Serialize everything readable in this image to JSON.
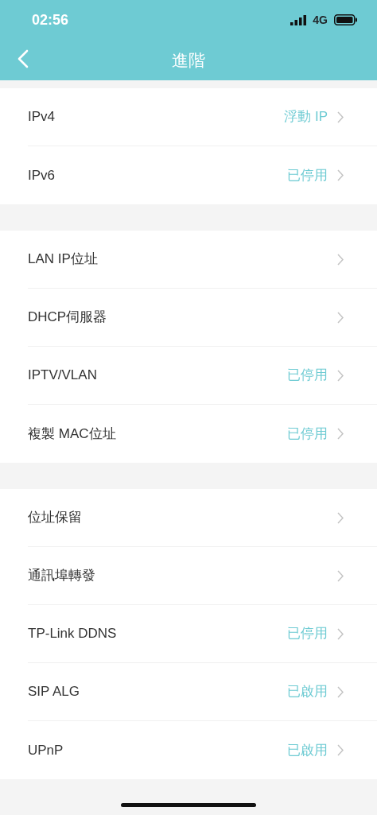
{
  "status_bar": {
    "time": "02:56",
    "network": "4G"
  },
  "header": {
    "title": "進階"
  },
  "groups": [
    {
      "rows": [
        {
          "label": "IPv4",
          "value": "浮動 IP"
        },
        {
          "label": "IPv6",
          "value": "已停用"
        }
      ]
    },
    {
      "rows": [
        {
          "label": "LAN IP位址"
        },
        {
          "label": "DHCP伺服器"
        },
        {
          "label": "IPTV/VLAN",
          "value": "已停用"
        },
        {
          "label": "複製 MAC位址",
          "value": "已停用"
        }
      ]
    },
    {
      "rows": [
        {
          "label": "位址保留"
        },
        {
          "label": "通訊埠轉發"
        },
        {
          "label": "TP-Link DDNS",
          "value": "已停用"
        },
        {
          "label": "SIP ALG",
          "value": "已啟用"
        },
        {
          "label": "UPnP",
          "value": "已啟用"
        }
      ]
    }
  ]
}
